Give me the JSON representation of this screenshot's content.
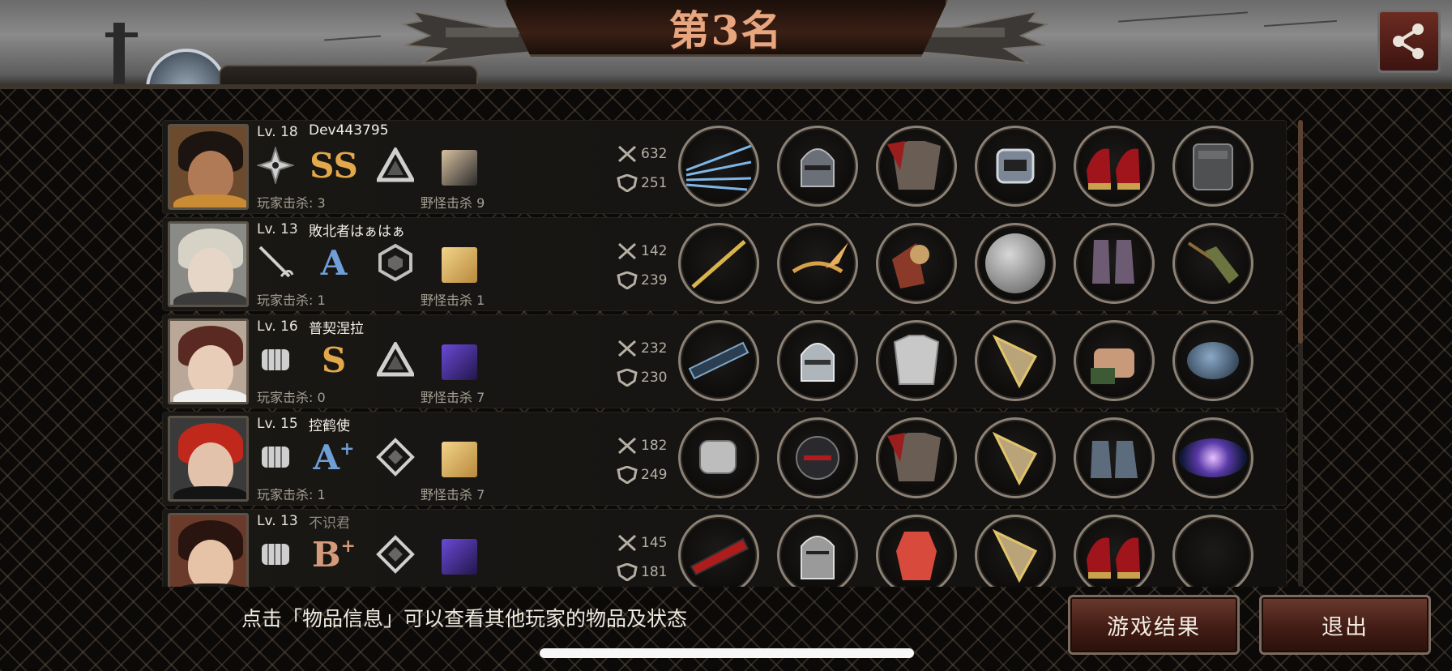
{
  "header": {
    "title": "第3名",
    "share_icon": "share-icon"
  },
  "players": [
    {
      "level": "Lv. 18",
      "name": "Dev443795",
      "name_dim": false,
      "weapon_icon": "shuriken-icon",
      "rank": "SS",
      "rank_sup": "",
      "rank_color": "#e2a94a",
      "emblem_icon": "triangle-emblem-icon",
      "kills_label": "玩家击杀: 3",
      "monster_label": "野怪击杀 9",
      "attack": "632",
      "defense": "251",
      "equipment": [
        "lightning-claw-weapon",
        "knight-helmet",
        "red-plate-armor",
        "stopwatch-ring",
        "red-high-heels",
        "camo-backpack"
      ]
    },
    {
      "level": "Lv. 13",
      "name": "敗北者はぁはぁ",
      "name_dim": false,
      "weapon_icon": "rapier-icon",
      "rank": "A",
      "rank_sup": "",
      "rank_color": "#6f9fd6",
      "emblem_icon": "hexagon-emblem-icon",
      "kills_label": "玩家击杀: 1",
      "monster_label": "野怪击杀 1",
      "attack": "142",
      "defense": "239",
      "equipment": [
        "golden-sword",
        "winged-circlet",
        "golden-gauntlet-armor",
        "steel-disc",
        "purple-boots",
        "bow-quiver"
      ]
    },
    {
      "level": "Lv. 16",
      "name": "普契涅拉",
      "name_dim": false,
      "weapon_icon": "fist-icon",
      "rank": "S",
      "rank_sup": "",
      "rank_color": "#e2a94a",
      "emblem_icon": "triangle-emblem-icon",
      "kills_label": "玩家击杀: 0",
      "monster_label": "野怪击杀 7",
      "attack": "232",
      "defense": "230",
      "equipment": [
        "dark-claw-weapon",
        "silver-helmet",
        "silver-plate-armor",
        "golden-shield",
        "bandaged-gauntlet",
        "blue-orb"
      ]
    },
    {
      "level": "Lv. 15",
      "name": "控鹤使",
      "name_dim": false,
      "weapon_icon": "fist-icon",
      "rank": "A",
      "rank_sup": "+",
      "rank_color": "#6f9fd6",
      "emblem_icon": "diamond-emblem-icon",
      "kills_label": "玩家击杀: 1",
      "monster_label": "野怪击杀 7",
      "attack": "182",
      "defense": "249",
      "equipment": [
        "steel-gauntlet",
        "black-helmet",
        "red-plate-armor",
        "golden-shield",
        "steel-boots",
        "galaxy-orb"
      ]
    },
    {
      "level": "Lv. 13",
      "name": "不识君",
      "name_dim": true,
      "weapon_icon": "fist-icon",
      "rank": "B",
      "rank_sup": "+",
      "rank_color": "#d49a7a",
      "emblem_icon": "diamond-emblem-icon",
      "kills_label": "",
      "monster_label": "",
      "attack": "145",
      "defense": "181",
      "equipment": [
        "red-claw-weapon",
        "great-helm",
        "red-bodysuit",
        "golden-shield",
        "red-high-heels",
        "empty-slot"
      ]
    }
  ],
  "footer": {
    "hint": "点击「物品信息」可以查看其他玩家的物品及状态",
    "results_button": "游戏结果",
    "exit_button": "退出"
  }
}
